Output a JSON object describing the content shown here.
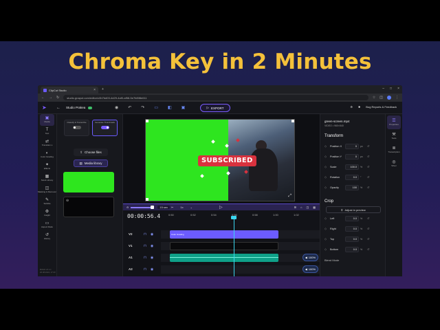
{
  "headline": "Chroma Key in 2 Minutes",
  "browser": {
    "tab_title": "ClipCut Studio",
    "url": "studio.gnaput.com/editor/c0b7bd03-4d29-4af0-af58-5e7fd5f8e611",
    "close_glyph": "×",
    "new_tab_glyph": "+",
    "window_controls": [
      "–",
      "□",
      "×"
    ]
  },
  "app_header": {
    "project_name": "Studio Prakea",
    "export_label": "EXPORT",
    "bug_report_label": "Bug Reports & Feedback"
  },
  "left_nav": [
    {
      "icon": "▣",
      "label": "Media",
      "active": true
    },
    {
      "icon": "T",
      "label": "Text"
    },
    {
      "icon": "⇄",
      "label": "Transition s"
    },
    {
      "icon": "◐",
      "label": "Color Grading"
    },
    {
      "icon": "✦",
      "label": "Effects"
    },
    {
      "icon": "▦",
      "label": "Stock Library"
    },
    {
      "icon": "◫",
      "label": "Masking & Remover"
    },
    {
      "icon": "✎",
      "label": "Subtitle"
    },
    {
      "icon": "⚙",
      "label": "Insight"
    },
    {
      "icon": "▭",
      "label": "Aspect Ratio"
    },
    {
      "icon": "↺",
      "label": "History"
    }
  ],
  "version_text": "BUILD v0.1.1  26.08.2024, 17:23",
  "media_panel": {
    "toggle_1": "Classify & Transcribe",
    "toggle_2": "Generate Thumbnails",
    "choose_files": "Choose files",
    "media_library": "Media library"
  },
  "preview": {
    "overlay_text": "SUBSCRIBED"
  },
  "playbar": {
    "zoom_value": "15 sec",
    "speed": "1x"
  },
  "timeline": {
    "timecode": "00:00:56.4",
    "ruler": [
      "0:50",
      "0:52",
      "0:54",
      "0:56",
      "0:58",
      "1:00",
      "1:02"
    ],
    "tracks": [
      {
        "label": "V2",
        "clip": "Color Grading"
      },
      {
        "label": "V1",
        "clip": ""
      },
      {
        "label": "A1",
        "clip": "",
        "volume": "100%"
      },
      {
        "label": "A2",
        "clip": "",
        "volume": "100%"
      }
    ]
  },
  "properties": {
    "file_name": "green-screen.mp4",
    "file_meta": "VIDEO • 960×540",
    "transform_title": "Transform",
    "transform": [
      {
        "label": "Position X",
        "value": "0",
        "unit": "px"
      },
      {
        "label": "Position Y",
        "value": "0",
        "unit": "px"
      },
      {
        "label": "Scale",
        "value": "100.0",
        "unit": "%"
      },
      {
        "label": "Rotation",
        "value": "0.0",
        "unit": "°"
      },
      {
        "label": "Opacity",
        "value": "100",
        "unit": "%"
      }
    ],
    "crop_title": "Crop",
    "adjust_label": "Adjust in preview",
    "crop": [
      {
        "label": "Left",
        "value": "0.0",
        "unit": "%"
      },
      {
        "label": "Right",
        "value": "0.0",
        "unit": "%"
      },
      {
        "label": "Top",
        "value": "0.0",
        "unit": "%"
      },
      {
        "label": "Bottom",
        "value": "0.0",
        "unit": "%"
      }
    ],
    "blend_mode_label": "Blend Mode"
  },
  "right_nav": [
    {
      "icon": "☰",
      "label": "Properties",
      "active": true
    },
    {
      "icon": "⚒",
      "label": "Tools"
    },
    {
      "icon": "≣",
      "label": "Transcription"
    },
    {
      "icon": "◎",
      "label": "Silver"
    }
  ],
  "colors": {
    "headline": "#f4c13a",
    "accent": "#7b5cff",
    "chroma_green": "#2ee61e",
    "subscribed_red": "#d9323e",
    "playhead": "#3ad7f0"
  }
}
